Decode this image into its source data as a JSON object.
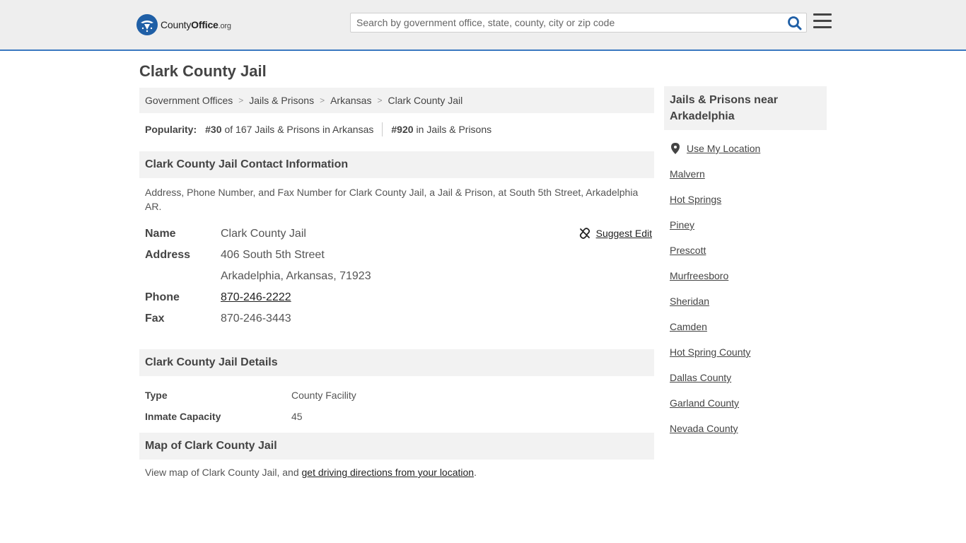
{
  "header": {
    "logo": {
      "brand_a": "County",
      "brand_b": "Office",
      "brand_c": ".org"
    },
    "search": {
      "placeholder": "Search by government office, state, county, city or zip code",
      "value": ""
    }
  },
  "page": {
    "title": "Clark County Jail"
  },
  "breadcrumb": [
    "Government Offices",
    "Jails & Prisons",
    "Arkansas",
    "Clark County Jail"
  ],
  "popularity": {
    "label": "Popularity:",
    "state_rank": "#30",
    "state_text": "of 167 Jails & Prisons in Arkansas",
    "national_rank": "#920",
    "national_text": "in Jails & Prisons"
  },
  "contact": {
    "heading": "Clark County Jail Contact Information",
    "description": "Address, Phone Number, and Fax Number for Clark County Jail, a Jail & Prison, at South 5th Street, Arkadelphia AR.",
    "suggest_edit": "Suggest Edit",
    "rows": {
      "name": {
        "label": "Name",
        "value": "Clark County Jail"
      },
      "address": {
        "label": "Address",
        "line1": "406 South 5th Street",
        "line2": "Arkadelphia, Arkansas, 71923"
      },
      "phone": {
        "label": "Phone",
        "value": "870-246-2222"
      },
      "fax": {
        "label": "Fax",
        "value": "870-246-3443"
      }
    }
  },
  "details": {
    "heading": "Clark County Jail Details",
    "type": {
      "label": "Type",
      "value": "County Facility"
    },
    "capacity": {
      "label": "Inmate Capacity",
      "value": "45"
    }
  },
  "map": {
    "heading": "Map of Clark County Jail",
    "text_before": "View map of Clark County Jail, and ",
    "link": "get driving directions from your location",
    "text_after": "."
  },
  "sidebar": {
    "heading": "Jails & Prisons near Arkadelphia",
    "use_location": "Use My Location",
    "items": [
      "Malvern",
      "Hot Springs",
      "Piney",
      "Prescott",
      "Murfreesboro",
      "Sheridan",
      "Camden",
      "Hot Spring County",
      "Dallas County",
      "Garland County",
      "Nevada County"
    ]
  },
  "colors": {
    "accent": "#3a78c0",
    "brand": "#1f5fa6",
    "panel": "#f2f2f2"
  },
  "icons": {
    "search": "search-icon",
    "menu": "hamburger-menu-icon",
    "edit": "broken-link-icon",
    "location": "map-pin-icon"
  }
}
